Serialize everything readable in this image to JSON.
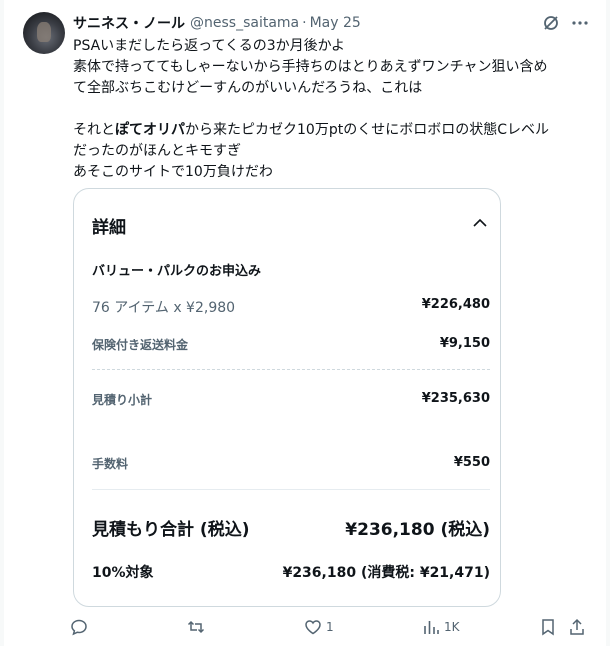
{
  "post": {
    "display_name": "サニネス・ノール",
    "handle": "@ness_saitama",
    "separator": "·",
    "date": "May 25",
    "lines": [
      "PSAいまだしたら返ってくるの3か月後かよ",
      "素体で持っててもしゃーないから手持ちのはとりあえずワンチャン狙い含め",
      "て全部ぶちこむけどーすんのがいいんだろうね、これは"
    ],
    "line4_pre": "それと",
    "line4_bold": "ぽてオリパ",
    "line4_post": "から来たピカゼク10万ptのくせにボロボロの状態Cレベル",
    "line5": "だったのがほんとキモすぎ",
    "line6": "あそこのサイトで10万負けだわ"
  },
  "card": {
    "title": "詳細",
    "section": "バリュー・パルクのお申込み",
    "items_label": "76 アイテム x ¥2,980",
    "items_value": "¥226,480",
    "shipping_label": "保険付き返送料金",
    "shipping_value": "¥9,150",
    "subtotal_label": "見積り小計",
    "subtotal_value": "¥235,630",
    "fee_label": "手数料",
    "fee_value": "¥550",
    "total_label": "見積もり合計 (税込)",
    "total_value": "¥236,180 (税込)",
    "tax_label": "10%対象",
    "tax_value": "¥236,180 (消費税: ¥21,471)"
  },
  "actions": {
    "reply_count": "",
    "repost_count": "",
    "like_count": "1",
    "views_count": "1K"
  },
  "colors": {
    "text": "#0f1419",
    "secondary": "#536471",
    "border": "#cfd9de"
  }
}
